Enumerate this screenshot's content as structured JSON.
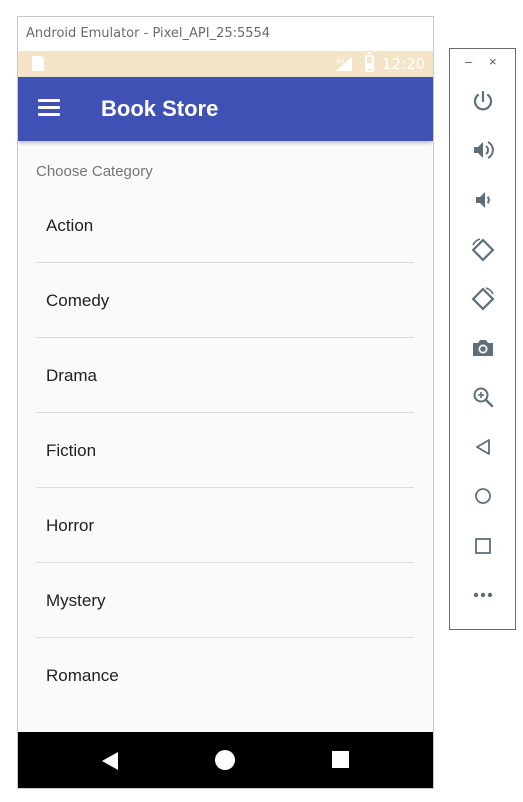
{
  "window": {
    "title": "Android Emulator - Pixel_API_25:5554"
  },
  "status_bar": {
    "time": "12:20",
    "color": "#f4e5c8"
  },
  "app_bar": {
    "title": "Book Store",
    "color": "#3f51b5",
    "menu_icon": "hamburger-menu-icon"
  },
  "content": {
    "section_header": "Choose Category",
    "categories": [
      {
        "label": "Action"
      },
      {
        "label": "Comedy"
      },
      {
        "label": "Drama"
      },
      {
        "label": "Fiction"
      },
      {
        "label": "Horror"
      },
      {
        "label": "Mystery"
      },
      {
        "label": "Romance"
      }
    ]
  },
  "nav_bar": {
    "buttons": [
      "back-icon",
      "home-icon",
      "recents-icon"
    ]
  },
  "side_toolbar": {
    "window_controls": {
      "minimize": "–",
      "close": "×"
    },
    "buttons": [
      "power-icon",
      "volume-up-icon",
      "volume-down-icon",
      "rotate-left-icon",
      "rotate-right-icon",
      "camera-icon",
      "zoom-icon",
      "back-icon",
      "home-icon",
      "overview-icon",
      "more-icon"
    ],
    "icon_color": "#5f6f7a"
  }
}
